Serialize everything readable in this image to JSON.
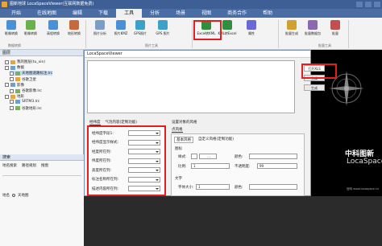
{
  "window": {
    "title": "图新地球 LocaSpaceViewer(互联网数据免费)"
  },
  "menu": {
    "items": [
      "开始",
      "在线地图",
      "编辑",
      "下载",
      "工具",
      "分析",
      "场景",
      "视图",
      "商务合作",
      "帮助"
    ],
    "active_index": 4
  },
  "ribbon": {
    "buttons": [
      {
        "label": "影像转换",
        "color": "#4b8fd6"
      },
      {
        "label": "影像转换",
        "color": "#6ab04c"
      },
      {
        "label": "高程转换",
        "color": "#4b8fd6"
      },
      {
        "label": "地形转换",
        "color": "#c86a3d"
      },
      {
        "label": "照片分析",
        "color": "#7a9ec8"
      },
      {
        "label": "照片KMZ",
        "color": "#4b8fd6"
      },
      {
        "label": "GPS照片",
        "color": "#3da0c8"
      },
      {
        "label": "GPS 照片",
        "color": "#3da0c8"
      },
      {
        "label": "Excel转KML",
        "color": "#2f8f3e"
      },
      {
        "label": "KML转Excel",
        "color": "#2f8f3e"
      },
      {
        "label": "属性",
        "color": "#6a6ad6"
      },
      {
        "label": "批量生成",
        "color": "#d0a030"
      },
      {
        "label": "批量数据包",
        "color": "#8a6ab0"
      },
      {
        "label": "批量",
        "color": "#c05050"
      }
    ],
    "groups": [
      "数据转换",
      "照片工具",
      "批量工具"
    ]
  },
  "layer_panel": {
    "title": "图层",
    "items": [
      {
        "label": "我的图层(tu_xin)",
        "indent": 1
      },
      {
        "label": "数据",
        "indent": 1
      },
      {
        "label": "天地图道路标注.lrc",
        "indent": 2,
        "selected": true
      },
      {
        "label": "谷歌卫星",
        "indent": 2
      },
      {
        "label": "影像",
        "indent": 1
      },
      {
        "label": "谷歌影像.lrc",
        "indent": 2
      },
      {
        "label": "地形",
        "indent": 1
      },
      {
        "label": "SRTM3.lrc",
        "indent": 2
      },
      {
        "label": "谷歌地形.lrc",
        "indent": 2
      }
    ]
  },
  "search_panel": {
    "title": "搜索",
    "tabs": [
      "地名搜索",
      "路径规划",
      "搜图"
    ],
    "option_label": "地名",
    "option_value": "天地图"
  },
  "dialog": {
    "title": "LocaSpaceViewer",
    "open_button": "打开XLS",
    "other_buttons": [
      "生成",
      "生成"
    ],
    "tabs_left": [
      "经纬度",
      "气泡内容(定制功能)"
    ],
    "fields": [
      "经纬度字段1:",
      "经纬度显示样式:",
      "经度所在列:",
      "纬度所在列:",
      "高度所在列:",
      "标注名称所在列:",
      "描述内容所在列:"
    ],
    "right_section_title": "设置对象的风格",
    "right_tabs": [
      "点风格"
    ],
    "right_subtabs": [
      "基本风格",
      "自定义风格(定制功能)"
    ],
    "icon_group": "图标",
    "label_style": "样式:",
    "label_color": "颜色:",
    "label_scale": "比例:",
    "scale_value": "1",
    "label_opacity": "不透明度:",
    "opacity_value": "99",
    "text_group": "文字",
    "label_font_size": "字体大小:",
    "font_size_value": "1",
    "label_text_color": "颜色:"
  },
  "logo": {
    "line1": "中科图新",
    "line2": "LocaSpace",
    "line3": "官网 www.locaspace.cn"
  }
}
